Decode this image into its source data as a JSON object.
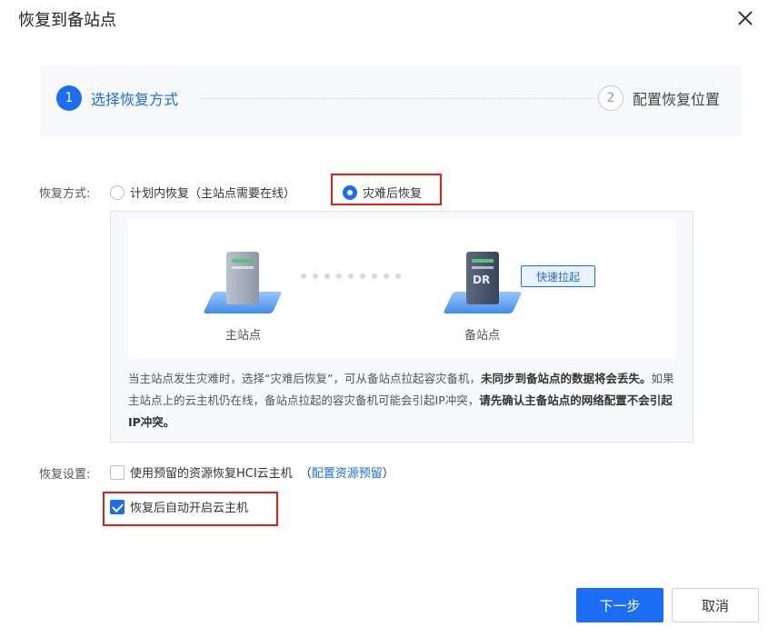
{
  "dialog": {
    "title": "恢复到备站点"
  },
  "steps": [
    {
      "number": "1",
      "label": "选择恢复方式"
    },
    {
      "number": "2",
      "label": "配置恢复位置"
    }
  ],
  "recovery_method": {
    "label": "恢复方式:",
    "options": [
      {
        "label": "计划内恢复（主站点需要在线）",
        "selected": false
      },
      {
        "label": "灾难后恢复",
        "selected": true
      }
    ]
  },
  "diagram": {
    "primary_site": "主站点",
    "backup_site": "备站点",
    "server_badge": "DR",
    "fast_boot_label": "快速拉起"
  },
  "description": {
    "p1": "当主站点发生灾难时，选择“灾难后恢复”，可从备站点拉起容灾备机，",
    "p1_bold": "未同步到备站点的数据将会丢失。",
    "p2": "如果主站点上的云主机仍在线，备站点拉起的容灾备机可能会引起IP冲突，",
    "p2_bold": "请先确认主备站点的网络配置不会引起IP冲突。"
  },
  "recovery_settings": {
    "label": "恢复设置:",
    "use_reserved": {
      "label": "使用预留的资源恢复HCI云主机",
      "checked": false,
      "paren_open": "（",
      "link": "配置资源预留",
      "paren_close": "）"
    },
    "auto_start": {
      "label": "恢复后自动开启云主机",
      "checked": true
    }
  },
  "buttons": {
    "next": "下一步",
    "cancel": "取消"
  },
  "colors": {
    "primary": "#1b6ef3",
    "highlight": "#e0201b"
  }
}
